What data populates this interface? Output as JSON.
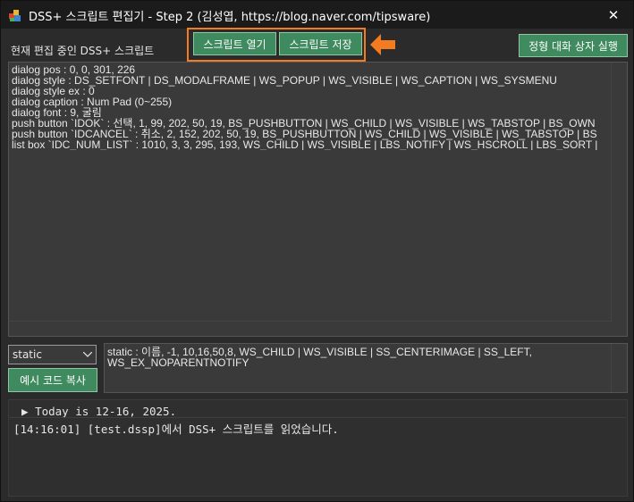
{
  "window": {
    "title": "DSS+ 스크립트 편집기 - Step 2 (김성엽, https://blog.naver.com/tipsware)",
    "close_glyph": "✕"
  },
  "editing_label": "현재 편집 중인 DSS+ 스크립트",
  "buttons": {
    "open_script": "스크립트 열기",
    "save_script": "스크립트 저장",
    "run_dialog": "정형 대화 상자 실행",
    "copy_example": "예시 코드 복사"
  },
  "highlight_color": "#f47b20",
  "accent_button_color": "#3f8a5e",
  "script_lines": [
    "dialog pos : 0, 0, 301, 226",
    "dialog style : DS_SETFONT | DS_MODALFRAME | WS_POPUP | WS_VISIBLE | WS_CAPTION | WS_SYSMENU",
    "dialog style ex : 0",
    "dialog caption : Num Pad (0~255)",
    "dialog font : 9, 굴림",
    "push button `IDOK` : 선택, 1, 99, 202, 50, 19, BS_PUSHBUTTON | WS_CHILD | WS_VISIBLE | WS_TABSTOP | BS_OWN",
    "push button `IDCANCEL` : 취소, 2, 152, 202, 50, 19, BS_PUSHBUTTON | WS_CHILD | WS_VISIBLE | WS_TABSTOP | BS",
    "list box `IDC_NUM_LIST` : 1010, 3, 3, 295, 193, WS_CHILD | WS_VISIBLE | LBS_NOTIFY | WS_HSCROLL | LBS_SORT |"
  ],
  "control_type_select": {
    "selected": "static"
  },
  "example_code": "static : 이름, -1, 10,16,50,8, WS_CHILD | WS_VISIBLE | SS_CENTERIMAGE | SS_LEFT,\nWS_EX_NOPARENTNOTIFY",
  "log": {
    "today": "Today is 12-16, 2025.",
    "messages": [
      "[14:16:01] [test.dssp]에서 DSS+ 스크립트를 읽었습니다."
    ]
  }
}
